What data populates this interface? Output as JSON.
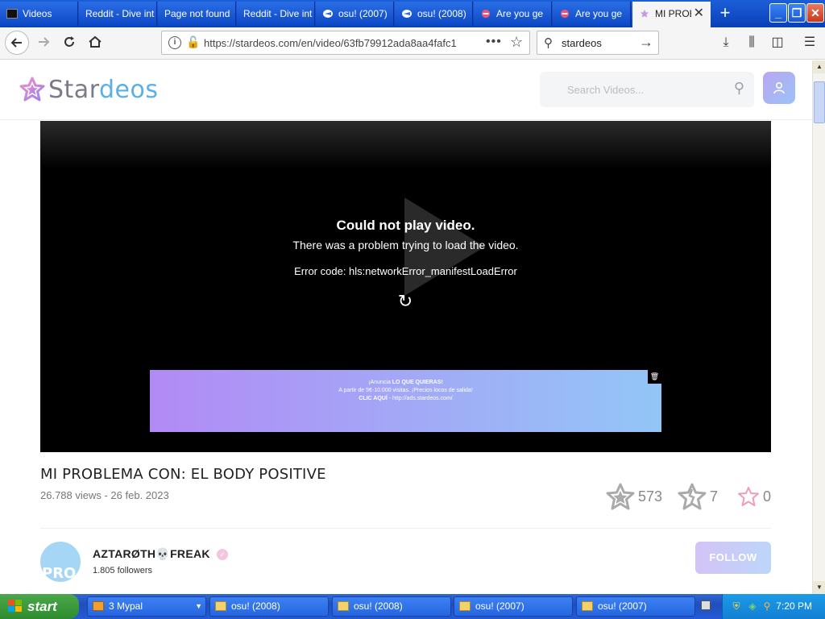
{
  "browser": {
    "tabs": [
      {
        "label": "Videos",
        "icon": "video-icon"
      },
      {
        "label": "Reddit - Dive int",
        "icon": "reddit-icon"
      },
      {
        "label": "Page not found",
        "icon": "page-icon"
      },
      {
        "label": "Reddit - Dive int",
        "icon": "reddit-icon"
      },
      {
        "label": "osu! (2007)",
        "icon": "osu-icon"
      },
      {
        "label": "osu! (2008)",
        "icon": "osu-icon"
      },
      {
        "label": "Are you ge",
        "icon": "site-icon"
      },
      {
        "label": "Are you ge",
        "icon": "site-icon"
      },
      {
        "label": "MI PROB",
        "icon": "stardeos-icon",
        "active": true
      }
    ],
    "new_tab": "+",
    "url": "https://stardeos.com/en/video/63fb79912ada8aa4fafc1",
    "url_more": "•••",
    "search_value": "stardeos",
    "window_buttons": {
      "minimize": "_",
      "restore": "❐",
      "close": "✕"
    }
  },
  "site": {
    "logo_text_a": "Star",
    "logo_text_b": "deos",
    "search_placeholder": "Search Videos...",
    "accent": "#5ab0e6"
  },
  "player": {
    "error_title": "Could not play video.",
    "error_message": "There was a problem trying to load the video.",
    "error_code": "Error code: hls:networkError_manifestLoadError",
    "ad": {
      "line1_a": "¡Anuncia ",
      "line1_b": "LO QUE QUIERAS!",
      "line2": "A partir de 5€-10.000 visitas. ¡Precios locos de salida!",
      "line3_a": "CLIC AQUÍ",
      "line3_b": " - http://ads.stardeos.com/"
    }
  },
  "video": {
    "title": "MI PROBLEMA CON: EL BODY POSITIVE",
    "meta": "26.788 views - 26 feb. 2023",
    "likes": "573",
    "dislikes": "7",
    "favs": "0"
  },
  "channel": {
    "name": "AZTARØTH💀FREAK",
    "followers": "1.805 followers",
    "avatar_text": "PRO",
    "follow_label": "FOLLOW"
  },
  "taskbar": {
    "start_label": "start",
    "tasks": [
      {
        "label": "3 Mypal"
      },
      {
        "label": "osu! (2008)"
      },
      {
        "label": "osu! (2008)"
      },
      {
        "label": "osu! (2007)"
      },
      {
        "label": "osu! (2007)"
      }
    ],
    "clock": "7:20 PM"
  }
}
